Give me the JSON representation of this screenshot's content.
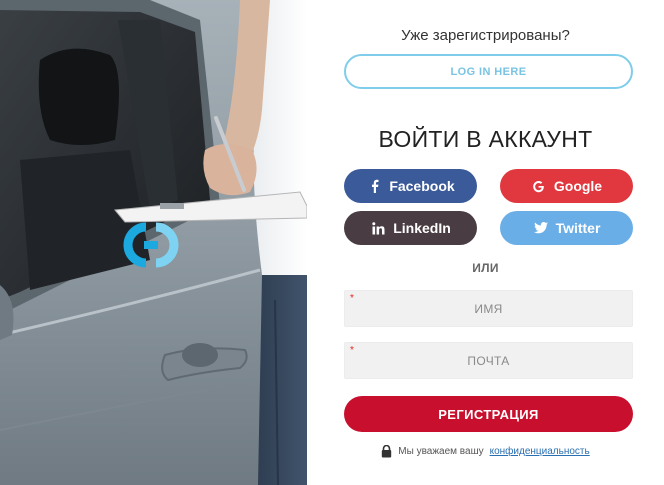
{
  "header": {
    "already_registered": "Уже зарегистрированы?",
    "login_button": "LOG IN HERE"
  },
  "form": {
    "title": "ВОЙТИ В АККАУНТ",
    "social": {
      "facebook": "Facebook",
      "google": "Google",
      "linkedin": "LinkedIn",
      "twitter": "Twitter"
    },
    "or_label": "ИЛИ",
    "name_field": {
      "placeholder": "ИМЯ",
      "required_mark": "*"
    },
    "email_field": {
      "placeholder": "ПОЧТА",
      "required_mark": "*"
    },
    "register_button": "РЕГИСТРАЦИЯ",
    "privacy": {
      "text": "Мы уважаем вашу",
      "link": "конфиденциальность"
    }
  },
  "colors": {
    "facebook": "#3b5a9a",
    "google": "#e0383e",
    "linkedin": "#4a3c43",
    "twitter": "#6aaee8",
    "register": "#c8102e",
    "login_outline": "#7fcdea",
    "logo_blue": "#1ba9e0"
  },
  "icons": {
    "facebook": "facebook-icon",
    "google": "google-icon",
    "linkedin": "linkedin-icon",
    "twitter": "twitter-icon",
    "lock": "lock-icon",
    "logo": "logo-icon"
  }
}
